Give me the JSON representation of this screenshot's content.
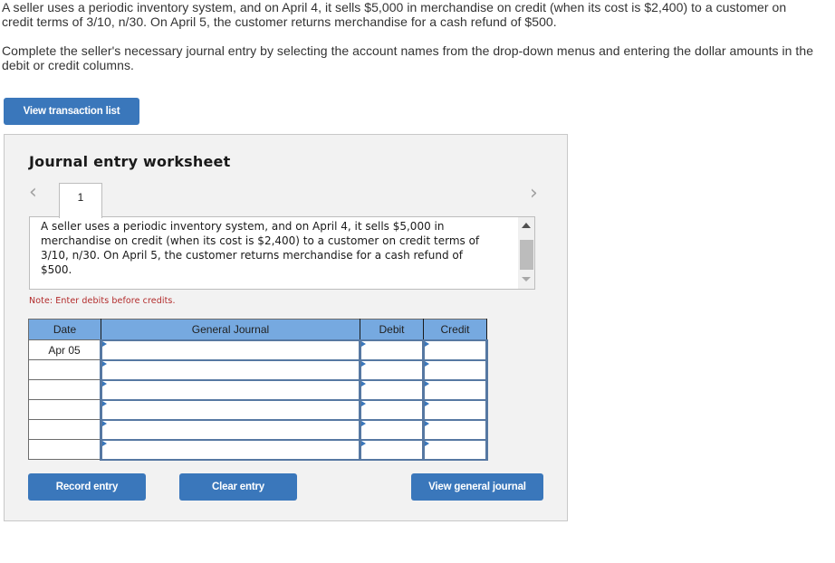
{
  "problem": {
    "paragraph1": "A seller uses a periodic inventory system, and on April 4, it sells $5,000 in merchandise on credit (when its cost is $2,400) to a customer on credit terms of 3/10, n/30. On April 5, the customer returns merchandise for a cash refund of $500.",
    "paragraph2": "Complete the seller's necessary journal entry by selecting the account names from the drop-down menus and entering the dollar amounts in the debit or credit columns."
  },
  "buttons": {
    "view_transaction_list": "View transaction list",
    "record_entry": "Record entry",
    "clear_entry": "Clear entry",
    "view_general_journal": "View general journal"
  },
  "worksheet": {
    "title": "Journal entry worksheet",
    "prev_icon": "‹",
    "next_icon": "›",
    "active_tab": "1",
    "description": "A seller uses a periodic inventory system, and on April 4, it sells $5,000 in merchandise on credit (when its cost is $2,400) to a customer on credit terms of 3/10, n/30. On April 5, the customer returns merchandise for a cash refund of $500.",
    "note": "Note: Enter debits before credits."
  },
  "journal": {
    "headers": [
      "Date",
      "General Journal",
      "Debit",
      "Credit"
    ],
    "rows": [
      {
        "date": "Apr 05",
        "account": "",
        "debit": "",
        "credit": ""
      },
      {
        "date": "",
        "account": "",
        "debit": "",
        "credit": ""
      },
      {
        "date": "",
        "account": "",
        "debit": "",
        "credit": ""
      },
      {
        "date": "",
        "account": "",
        "debit": "",
        "credit": ""
      },
      {
        "date": "",
        "account": "",
        "debit": "",
        "credit": ""
      },
      {
        "date": "",
        "account": "",
        "debit": "",
        "credit": ""
      }
    ]
  },
  "colors": {
    "button_blue": "#3a77bb",
    "header_blue": "#76a9e0",
    "cell_border": "#5678a2",
    "note_red": "#b22a2a"
  }
}
